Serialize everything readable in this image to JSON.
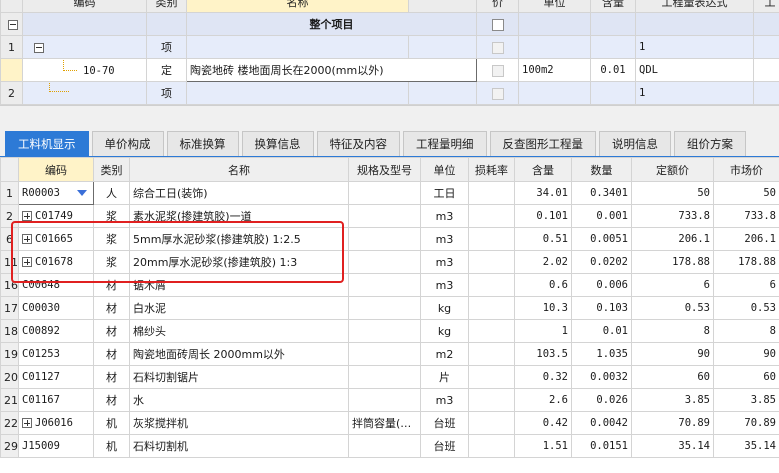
{
  "top_grid": {
    "headers": [
      "编码",
      "类别",
      "名称",
      "价",
      "单位",
      "含量",
      "工程量表达式",
      "工"
    ],
    "rows": [
      {
        "num": "",
        "code": "",
        "type": "",
        "name": "整个项目",
        "unit": "",
        "qty": "",
        "expr": ""
      },
      {
        "num": "1",
        "code": "",
        "type": "项",
        "name": "",
        "unit": "",
        "qty": "",
        "expr": "1"
      },
      {
        "num": "",
        "code": "10-70",
        "type": "定",
        "name": "陶瓷地砖 楼地面周长在2000(mm以外)",
        "unit": "100m2",
        "qty": "0.01",
        "expr": "QDL"
      },
      {
        "num": "2",
        "code": "",
        "type": "项",
        "name": "",
        "unit": "",
        "qty": "",
        "expr": "1"
      }
    ]
  },
  "tabs": [
    {
      "label": "工料机显示",
      "active": true
    },
    {
      "label": "单价构成",
      "active": false
    },
    {
      "label": "标准换算",
      "active": false
    },
    {
      "label": "换算信息",
      "active": false
    },
    {
      "label": "特征及内容",
      "active": false
    },
    {
      "label": "工程量明细",
      "active": false
    },
    {
      "label": "反查图形工程量",
      "active": false
    },
    {
      "label": "说明信息",
      "active": false
    },
    {
      "label": "组价方案",
      "active": false
    }
  ],
  "bottom_grid": {
    "headers": [
      "编码",
      "类别",
      "名称",
      "规格及型号",
      "单位",
      "损耗率",
      "含量",
      "数量",
      "定额价",
      "市场价"
    ],
    "rows": [
      {
        "num": "1",
        "expand": false,
        "code": "R00003",
        "type": "人",
        "name": "综合工日(装饰)",
        "spec": "",
        "unit": "工日",
        "loss": "",
        "content": "34.01",
        "qty": "0.3401",
        "price": "50",
        "market": "50"
      },
      {
        "num": "2",
        "expand": true,
        "code": "C01749",
        "type": "浆",
        "name": "素水泥浆(掺建筑胶)一道",
        "spec": "",
        "unit": "m3",
        "loss": "",
        "content": "0.101",
        "qty": "0.001",
        "price": "733.8",
        "market": "733.8"
      },
      {
        "num": "6",
        "expand": true,
        "code": "C01665",
        "type": "浆",
        "name": "5mm厚水泥砂浆(掺建筑胶) 1:2.5",
        "spec": "",
        "unit": "m3",
        "loss": "",
        "content": "0.51",
        "qty": "0.0051",
        "price": "206.1",
        "market": "206.1"
      },
      {
        "num": "11",
        "expand": true,
        "code": "C01678",
        "type": "浆",
        "name": "20mm厚水泥砂浆(掺建筑胶) 1:3",
        "spec": "",
        "unit": "m3",
        "loss": "",
        "content": "2.02",
        "qty": "0.0202",
        "price": "178.88",
        "market": "178.88"
      },
      {
        "num": "16",
        "expand": false,
        "code": "C00648",
        "type": "材",
        "name": "锯木屑",
        "spec": "",
        "unit": "m3",
        "loss": "",
        "content": "0.6",
        "qty": "0.006",
        "price": "6",
        "market": "6"
      },
      {
        "num": "17",
        "expand": false,
        "code": "C00030",
        "type": "材",
        "name": "白水泥",
        "spec": "",
        "unit": "kg",
        "loss": "",
        "content": "10.3",
        "qty": "0.103",
        "price": "0.53",
        "market": "0.53"
      },
      {
        "num": "18",
        "expand": false,
        "code": "C00892",
        "type": "材",
        "name": "棉纱头",
        "spec": "",
        "unit": "kg",
        "loss": "",
        "content": "1",
        "qty": "0.01",
        "price": "8",
        "market": "8"
      },
      {
        "num": "19",
        "expand": false,
        "code": "C01253",
        "type": "材",
        "name": "陶瓷地面砖周长 2000mm以外",
        "spec": "",
        "unit": "m2",
        "loss": "",
        "content": "103.5",
        "qty": "1.035",
        "price": "90",
        "market": "90"
      },
      {
        "num": "20",
        "expand": false,
        "code": "C01127",
        "type": "材",
        "name": "石料切割锯片",
        "spec": "",
        "unit": "片",
        "loss": "",
        "content": "0.32",
        "qty": "0.0032",
        "price": "60",
        "market": "60"
      },
      {
        "num": "21",
        "expand": false,
        "code": "C01167",
        "type": "材",
        "name": "水",
        "spec": "",
        "unit": "m3",
        "loss": "",
        "content": "2.6",
        "qty": "0.026",
        "price": "3.85",
        "market": "3.85"
      },
      {
        "num": "22",
        "expand": true,
        "code": "J06016",
        "type": "机",
        "name": "灰浆搅拌机",
        "spec": "拌筒容量(…",
        "unit": "台班",
        "loss": "",
        "content": "0.42",
        "qty": "0.0042",
        "price": "70.89",
        "market": "70.89"
      },
      {
        "num": "29",
        "expand": false,
        "code": "J15009",
        "type": "机",
        "name": "石料切割机",
        "spec": "",
        "unit": "台班",
        "loss": "",
        "content": "1.51",
        "qty": "0.0151",
        "price": "35.14",
        "market": "35.14"
      }
    ]
  },
  "colors": {
    "accent": "#2d7ad6",
    "highlight": "#e02020",
    "selected": "#fff3c8"
  }
}
